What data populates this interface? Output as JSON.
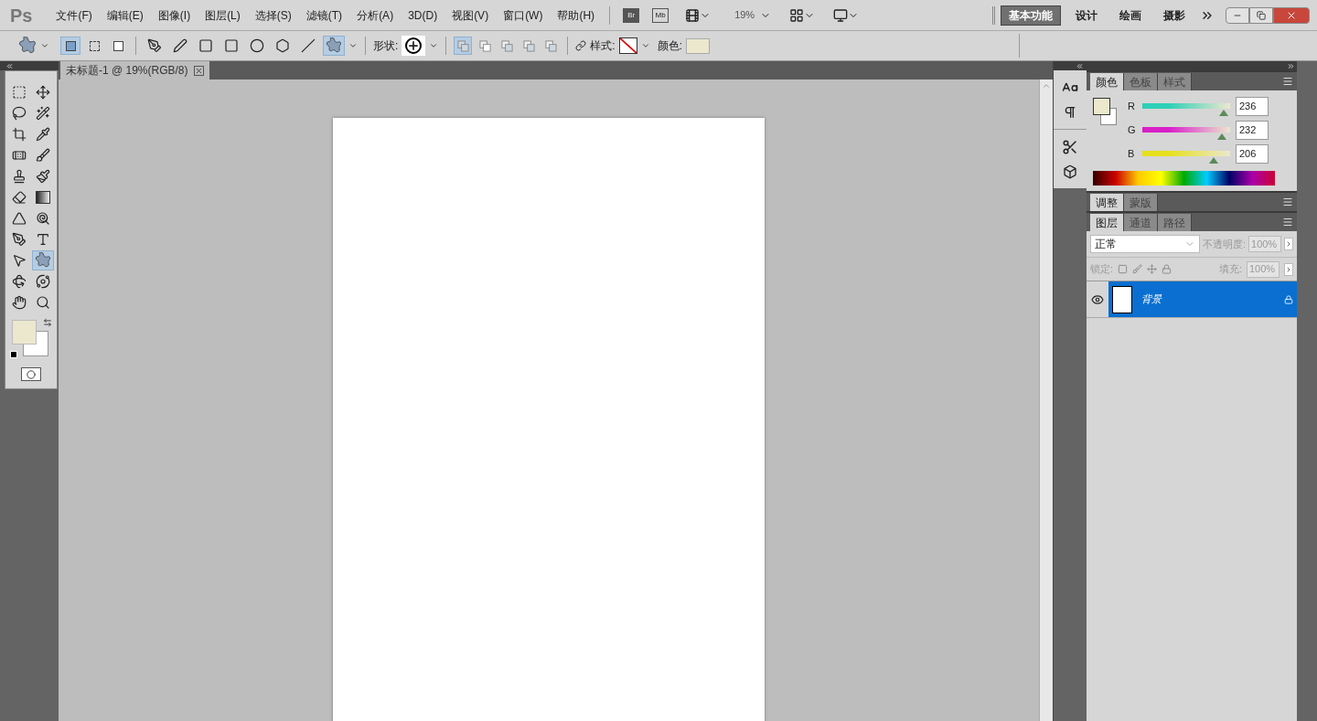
{
  "app": {
    "logo": "Ps",
    "bridge": "Br",
    "mini_bridge": "Mb",
    "zoom": "19%"
  },
  "menu": [
    "文件(F)",
    "编辑(E)",
    "图像(I)",
    "图层(L)",
    "选择(S)",
    "滤镜(T)",
    "分析(A)",
    "3D(D)",
    "视图(V)",
    "窗口(W)",
    "帮助(H)"
  ],
  "workspaces": [
    {
      "label": "基本功能",
      "selected": true
    },
    {
      "label": "设计",
      "selected": false
    },
    {
      "label": "绘画",
      "selected": false
    },
    {
      "label": "摄影",
      "selected": false
    }
  ],
  "options_bar": {
    "modes": [
      {
        "kind": "shape-layer",
        "selected": true
      },
      {
        "kind": "path",
        "selected": false
      },
      {
        "kind": "fill-pixels",
        "selected": false
      }
    ],
    "shape_tools": [
      {
        "kind": "pen",
        "selected": false
      },
      {
        "kind": "freeform-pen",
        "selected": false
      },
      {
        "kind": "rectangle",
        "selected": false
      },
      {
        "kind": "rounded-rectangle",
        "selected": false
      },
      {
        "kind": "ellipse",
        "selected": false
      },
      {
        "kind": "polygon",
        "selected": false
      },
      {
        "kind": "line",
        "selected": false
      },
      {
        "kind": "custom-shape",
        "selected": true
      }
    ],
    "shape_label": "形状:",
    "combine": [
      {
        "kind": "add",
        "selected": true
      },
      {
        "kind": "subtract",
        "selected": false
      },
      {
        "kind": "intersect",
        "selected": false
      },
      {
        "kind": "exclude",
        "selected": false
      },
      {
        "kind": "union",
        "selected": false
      }
    ],
    "style_label": "样式:",
    "color_label": "颜色:",
    "color": "#ece8ce"
  },
  "document_tab": {
    "title": "未标题-1 @ 19%(RGB/8)"
  },
  "tools": [
    {
      "kind": "marquee",
      "selected": false
    },
    {
      "kind": "move",
      "selected": false
    },
    {
      "kind": "lasso",
      "selected": false
    },
    {
      "kind": "quick-select",
      "selected": false
    },
    {
      "kind": "crop",
      "selected": false
    },
    {
      "kind": "eyedropper",
      "selected": false
    },
    {
      "kind": "healing",
      "selected": false
    },
    {
      "kind": "brush",
      "selected": false
    },
    {
      "kind": "stamp",
      "selected": false
    },
    {
      "kind": "history-brush",
      "selected": false
    },
    {
      "kind": "eraser",
      "selected": false
    },
    {
      "kind": "gradient",
      "selected": false
    },
    {
      "kind": "blur",
      "selected": false
    },
    {
      "kind": "dodge",
      "selected": false
    },
    {
      "kind": "pen",
      "selected": false
    },
    {
      "kind": "type",
      "selected": false
    },
    {
      "kind": "path-select",
      "selected": false
    },
    {
      "kind": "custom-shape",
      "selected": true
    },
    {
      "kind": "rotate-3d",
      "selected": false
    },
    {
      "kind": "orbit-3d",
      "selected": false
    },
    {
      "kind": "hand",
      "selected": false
    },
    {
      "kind": "zoom",
      "selected": false
    }
  ],
  "color_panel": {
    "tabs": [
      {
        "label": "颜色",
        "selected": true
      },
      {
        "label": "色板",
        "selected": false
      },
      {
        "label": "样式",
        "selected": false
      }
    ],
    "channels": [
      {
        "name": "R",
        "value": "236",
        "level": 0.925,
        "color": "#2ecfb8"
      },
      {
        "name": "G",
        "value": "232",
        "level": 0.91,
        "color": "#d81fc8"
      },
      {
        "name": "B",
        "value": "206",
        "level": 0.81,
        "color": "#e6e01c"
      }
    ]
  },
  "adjust_panel": {
    "tabs": [
      {
        "label": "调整",
        "selected": true
      },
      {
        "label": "蒙版",
        "selected": false
      }
    ]
  },
  "layers_panel": {
    "tabs": [
      {
        "label": "图层",
        "selected": true
      },
      {
        "label": "通道",
        "selected": false
      },
      {
        "label": "路径",
        "selected": false
      }
    ],
    "blend_mode": "正常",
    "opacity_label": "不透明度:",
    "opacity": "100%",
    "lock_label": "锁定:",
    "fill_label": "填充:",
    "fill": "100%",
    "layers": [
      {
        "name": "背景",
        "selected": true,
        "visible": true,
        "locked": true
      }
    ]
  }
}
